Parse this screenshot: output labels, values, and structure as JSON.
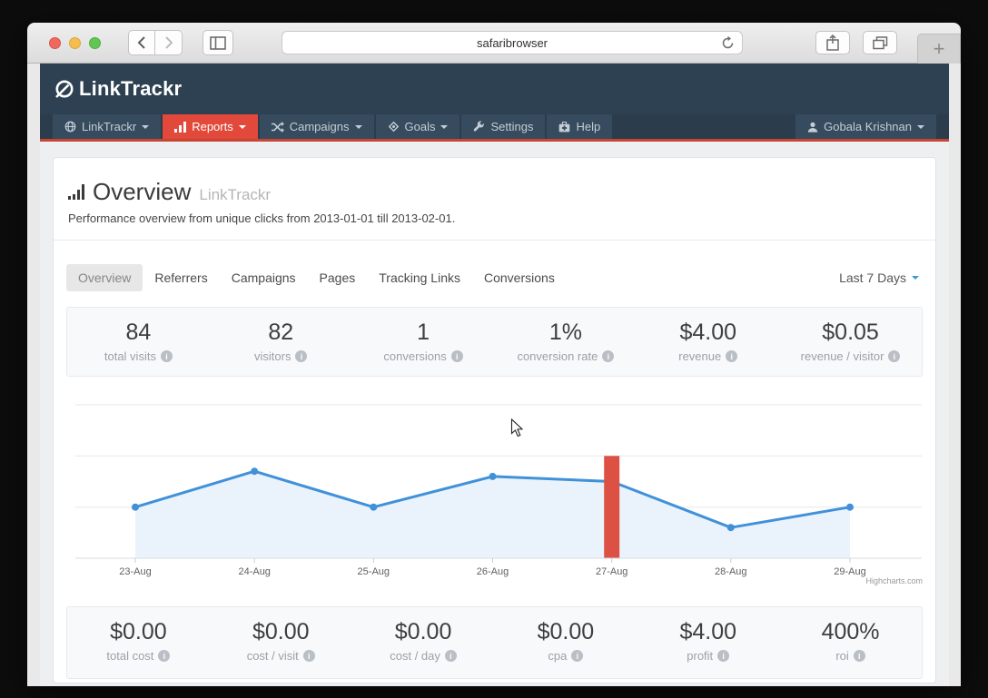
{
  "window": {
    "url": "safaribrowser",
    "traffic_light_colors": [
      "#ee6a5f",
      "#f5bd4f",
      "#62c554"
    ],
    "new_tab_label": "+"
  },
  "app": {
    "logo_text": "LinkTrackr",
    "nav": [
      {
        "label": "LinkTrackr",
        "icon": "globe-icon",
        "caret": true,
        "active": false
      },
      {
        "label": "Reports",
        "icon": "bar-chart-icon",
        "caret": true,
        "active": true
      },
      {
        "label": "Campaigns",
        "icon": "shuffle-icon",
        "caret": true,
        "active": false
      },
      {
        "label": "Goals",
        "icon": "crosshairs-icon",
        "caret": true,
        "active": false
      },
      {
        "label": "Settings",
        "icon": "wrench-icon",
        "caret": false,
        "active": false
      },
      {
        "label": "Help",
        "icon": "medkit-icon",
        "caret": false,
        "active": false
      }
    ],
    "user": {
      "label": "Gobala Krishnan",
      "icon": "user-icon"
    }
  },
  "page": {
    "title": "Overview",
    "title_suffix": "LinkTrackr",
    "subtitle": "Performance overview from unique clicks from 2013-01-01 till 2013-02-01.",
    "tabs": [
      {
        "label": "Overview",
        "active": true
      },
      {
        "label": "Referrers",
        "active": false
      },
      {
        "label": "Campaigns",
        "active": false
      },
      {
        "label": "Pages",
        "active": false
      },
      {
        "label": "Tracking Links",
        "active": false
      },
      {
        "label": "Conversions",
        "active": false
      }
    ],
    "date_range": "Last 7 Days"
  },
  "stats_top": [
    {
      "value": "84",
      "label": "total visits"
    },
    {
      "value": "82",
      "label": "visitors"
    },
    {
      "value": "1",
      "label": "conversions"
    },
    {
      "value": "1%",
      "label": "conversion rate"
    },
    {
      "value": "$4.00",
      "label": "revenue"
    },
    {
      "value": "$0.05",
      "label": "revenue / visitor"
    }
  ],
  "stats_bottom": [
    {
      "value": "$0.00",
      "label": "total cost"
    },
    {
      "value": "$0.00",
      "label": "cost / visit"
    },
    {
      "value": "$0.00",
      "label": "cost / day"
    },
    {
      "value": "$0.00",
      "label": "cpa"
    },
    {
      "value": "$4.00",
      "label": "profit"
    },
    {
      "value": "400%",
      "label": "roi"
    }
  ],
  "chart_data": {
    "type": "area",
    "title": "",
    "xlabel": "",
    "ylabel": "",
    "categories": [
      "23-Aug",
      "24-Aug",
      "25-Aug",
      "26-Aug",
      "27-Aug",
      "28-Aug",
      "29-Aug"
    ],
    "series": [
      {
        "name": "unique clicks",
        "values": [
          10,
          17,
          10,
          16,
          15,
          6,
          10
        ]
      }
    ],
    "annotation_bar": {
      "index": 4,
      "category": "27-Aug",
      "value": 20,
      "color": "#dd5144"
    },
    "ylim": [
      0,
      30
    ],
    "grid_step": 10,
    "grid": "horizontal",
    "legend_position": "none",
    "line_color": "#4191d9",
    "fill_color": "#eaf3fb",
    "credit": "Highcharts.com"
  },
  "colors": {
    "masthead_navy": "#2e4152",
    "nav_strip": "#2b3c4c",
    "nav_item": "#374b5e",
    "active_red": "#e2493b",
    "red_border": "#c64534",
    "page_bg": "#edeff0",
    "panel_bg": "#f8f9fa",
    "chart_line_blue": "#4191d9",
    "chart_bar_red": "#dd5144",
    "range_caret_blue": "#3a99d8"
  }
}
